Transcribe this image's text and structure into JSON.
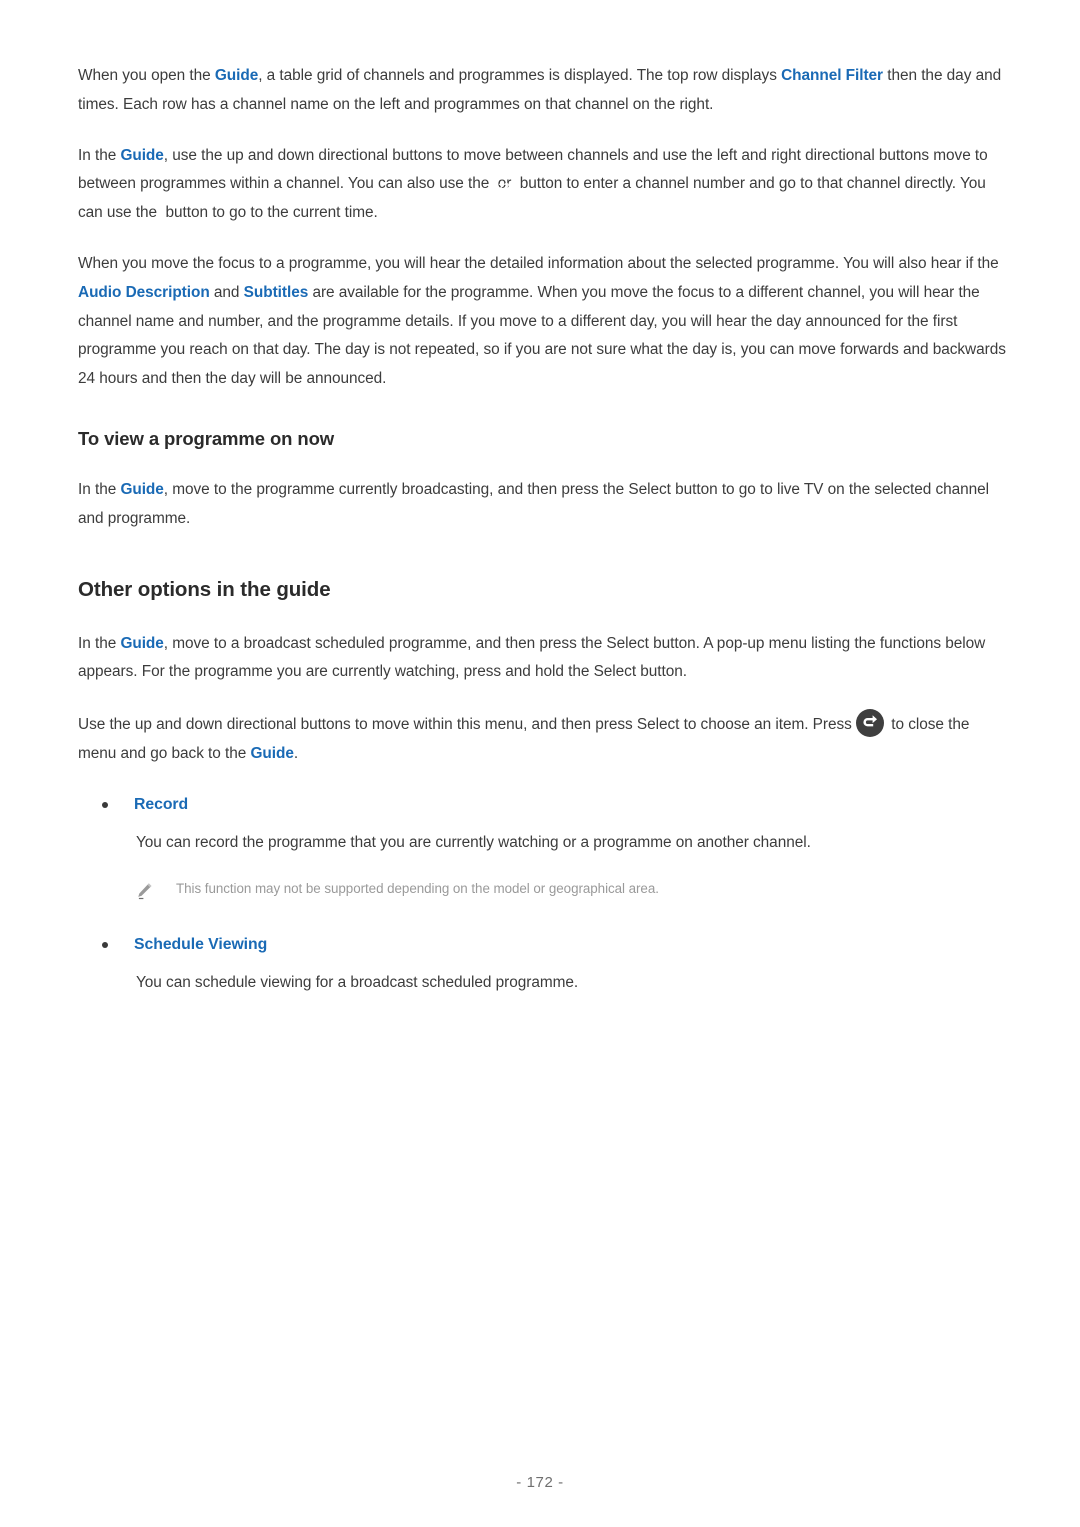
{
  "document": {
    "page_number": "- 172 -"
  },
  "paragraphs": {
    "p1": {
      "seg1": "When you open the ",
      "link1": "Guide",
      "seg2": ", a table grid of channels and programmes is displayed. The top row displays ",
      "link2": "Channel Filter",
      "seg3": " then the day and times. Each row has a channel name on the left and programmes on that channel on the right."
    },
    "p2": {
      "seg1": "In the ",
      "link1": "Guide",
      "seg2": ", use the up and down directional buttons to move between channels and use the left and right directional buttons move to between programmes within a channel. You can also use the ",
      "icon1": "colored-123-button-icon",
      "seg3": " or ",
      "icon2": "123-button-icon",
      "seg4": " button to enter a channel number and go to that channel directly. You can use the ",
      "icon3": "play-pause-button-icon",
      "seg5": " button to go to the current time."
    },
    "p3": {
      "seg1": "When you move the focus to a programme, you will hear the detailed information about the selected programme. You will also hear if the ",
      "link1": "Audio Description",
      "seg2": " and ",
      "link2": "Subtitles",
      "seg3": " are available for the programme. When you move the focus to a different channel, you will hear the channel name and number, and the programme details. If you move to a different day, you will hear the day announced for the first programme you reach on that day. The day is not repeated, so if you are not sure what the day is, you can move forwards and backwards 24 hours and then the day will be announced."
    },
    "p4": {
      "seg1": "In the ",
      "link1": "Guide",
      "seg2": ", move to the programme currently broadcasting, and then press the Select button to go to live TV on the selected channel and programme."
    },
    "p5": {
      "seg1": "In the ",
      "link1": "Guide",
      "seg2": ", move to a broadcast scheduled programme, and then press the Select button. A pop-up menu listing the functions below appears. For the programme you are currently watching, press and hold the Select button."
    },
    "p6": {
      "seg1": "Use the up and down directional buttons to move within this menu, and then press Select to choose an item. Press ",
      "icon1": "return-button-icon",
      "seg2": " to close the menu and go back to the ",
      "link1": "Guide",
      "seg3": "."
    }
  },
  "headings": {
    "h1": "To view a programme on now",
    "h2": "Other options in the guide"
  },
  "options": [
    {
      "label": "Record",
      "description": "You can record the programme that you are currently watching or a programme on another channel.",
      "note": "This function may not be supported depending on the model or geographical area."
    },
    {
      "label": "Schedule Viewing",
      "description": "You can schedule viewing for a broadcast scheduled programme.",
      "note": ""
    }
  ],
  "colors": {
    "link_blue": "#1a6ab5",
    "body_text": "#3c3c3c",
    "heading_text": "#2b2b2b",
    "note_text": "#9a9a9a",
    "icon_dark": "#4a4a4a",
    "dot_red": "#d62828",
    "dot_green": "#2e9b3c",
    "dot_yellow": "#e8c32a",
    "dot_blue": "#2a5fd0"
  }
}
